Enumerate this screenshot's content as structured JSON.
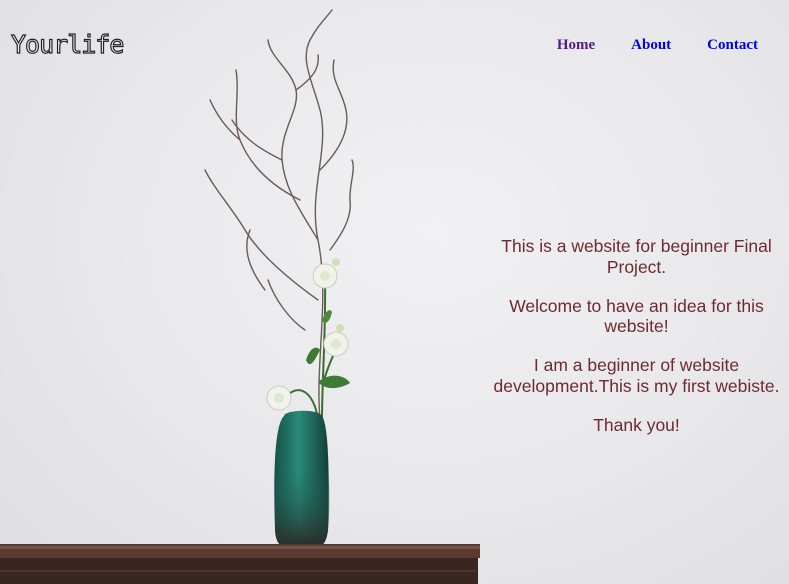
{
  "header": {
    "logo": "Yourlife",
    "nav": [
      {
        "label": "Home"
      },
      {
        "label": "About"
      },
      {
        "label": "Contact"
      }
    ]
  },
  "main": {
    "paragraphs": [
      "This is a website for beginner Final Project.",
      "Welcome to have an idea for this website!",
      "I am a beginner of website development.This is my first webiste.",
      "Thank you!"
    ]
  },
  "colors": {
    "text": "#6e2a30",
    "nav_visited": "#551a8b",
    "nav_link": "#0000ee",
    "vase": "#1d6b5f",
    "table": "#4a3028"
  }
}
